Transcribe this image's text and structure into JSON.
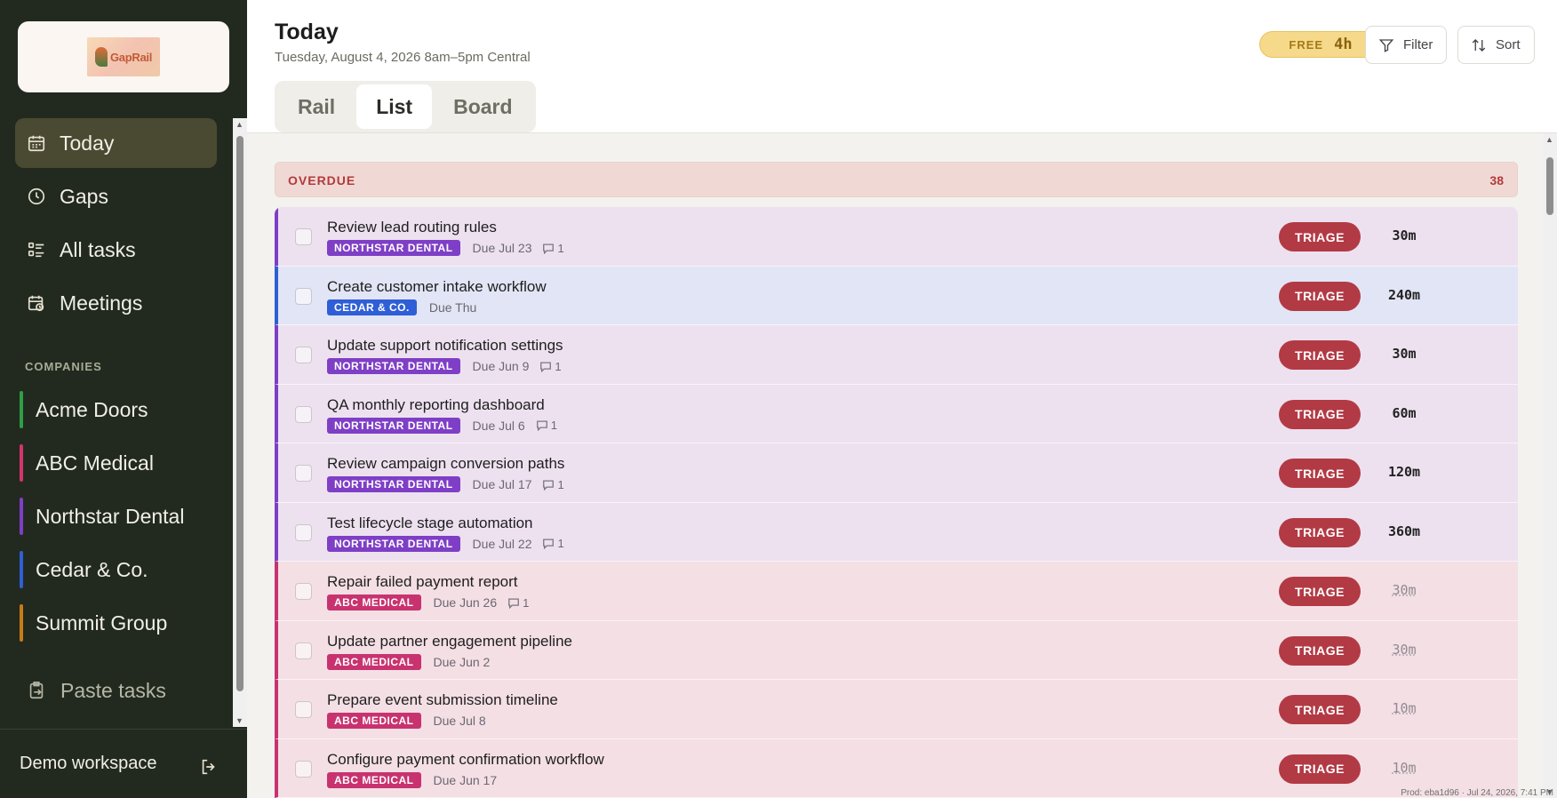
{
  "app": {
    "logo_text": "GapRail"
  },
  "sidebar": {
    "nav": [
      {
        "label": "Today",
        "icon": "calendar-icon",
        "active": true
      },
      {
        "label": "Gaps",
        "icon": "clock-icon",
        "active": false
      },
      {
        "label": "All tasks",
        "icon": "list-icon",
        "active": false
      },
      {
        "label": "Meetings",
        "icon": "calendar-clock-icon",
        "active": false
      }
    ],
    "companies_label": "COMPANIES",
    "companies": [
      {
        "label": "Acme Doors",
        "color": "#2f9e44"
      },
      {
        "label": "ABC Medical",
        "color": "#d6336c"
      },
      {
        "label": "Northstar Dental",
        "color": "#7e3fc6"
      },
      {
        "label": "Cedar & Co.",
        "color": "#2f5fd6"
      },
      {
        "label": "Summit Group",
        "color": "#c77d14"
      }
    ],
    "paste_label": "Paste tasks",
    "workspace": "Demo workspace"
  },
  "header": {
    "title": "Today",
    "subtitle": "Tuesday, August 4, 2026  8am–5pm Central",
    "tabs": [
      {
        "label": "Rail",
        "active": false
      },
      {
        "label": "List",
        "active": true
      },
      {
        "label": "Board",
        "active": false
      }
    ],
    "free_label": "FREE",
    "free_value": "4h",
    "filter_label": "Filter",
    "sort_label": "Sort"
  },
  "section": {
    "label": "OVERDUE",
    "count": "38"
  },
  "colors": {
    "northstar_tag": "#7e3fc6",
    "cedar_tag": "#2f5fd6",
    "abc_tag": "#c8336f",
    "northstar_row": "#ede1f0",
    "cedar_row": "#e2e5f5",
    "abc_row": "#f4dfe5",
    "triage": "#b23a44"
  },
  "tasks": [
    {
      "title": "Review lead routing rules",
      "company": "NORTHSTAR DENTAL",
      "kind": "northstar",
      "due": "Due Jul 23",
      "comments": "1",
      "status": "TRIAGE",
      "estimate": "30m",
      "dim": false
    },
    {
      "title": "Create customer intake workflow",
      "company": "CEDAR & CO.",
      "kind": "cedar",
      "due": "Due Thu",
      "comments": "",
      "status": "TRIAGE",
      "estimate": "240m",
      "dim": false
    },
    {
      "title": "Update support notification settings",
      "company": "NORTHSTAR DENTAL",
      "kind": "northstar",
      "due": "Due Jun 9",
      "comments": "1",
      "status": "TRIAGE",
      "estimate": "30m",
      "dim": false
    },
    {
      "title": "QA monthly reporting dashboard",
      "company": "NORTHSTAR DENTAL",
      "kind": "northstar",
      "due": "Due Jul 6",
      "comments": "1",
      "status": "TRIAGE",
      "estimate": "60m",
      "dim": false
    },
    {
      "title": "Review campaign conversion paths",
      "company": "NORTHSTAR DENTAL",
      "kind": "northstar",
      "due": "Due Jul 17",
      "comments": "1",
      "status": "TRIAGE",
      "estimate": "120m",
      "dim": false
    },
    {
      "title": "Test lifecycle stage automation",
      "company": "NORTHSTAR DENTAL",
      "kind": "northstar",
      "due": "Due Jul 22",
      "comments": "1",
      "status": "TRIAGE",
      "estimate": "360m",
      "dim": false
    },
    {
      "title": "Repair failed payment report",
      "company": "ABC MEDICAL",
      "kind": "abc",
      "due": "Due Jun 26",
      "comments": "1",
      "status": "TRIAGE",
      "estimate": "30m",
      "dim": true
    },
    {
      "title": "Update partner engagement pipeline",
      "company": "ABC MEDICAL",
      "kind": "abc",
      "due": "Due Jun 2",
      "comments": "",
      "status": "TRIAGE",
      "estimate": "30m",
      "dim": true
    },
    {
      "title": "Prepare event submission timeline",
      "company": "ABC MEDICAL",
      "kind": "abc",
      "due": "Due Jul 8",
      "comments": "",
      "status": "TRIAGE",
      "estimate": "10m",
      "dim": true
    },
    {
      "title": "Configure payment confirmation workflow",
      "company": "ABC MEDICAL",
      "kind": "abc",
      "due": "Due Jun 17",
      "comments": "",
      "status": "TRIAGE",
      "estimate": "10m",
      "dim": true
    }
  ],
  "footer": {
    "build": "Prod: eba1d96 · Jul 24, 2026, 7:41 PM"
  }
}
